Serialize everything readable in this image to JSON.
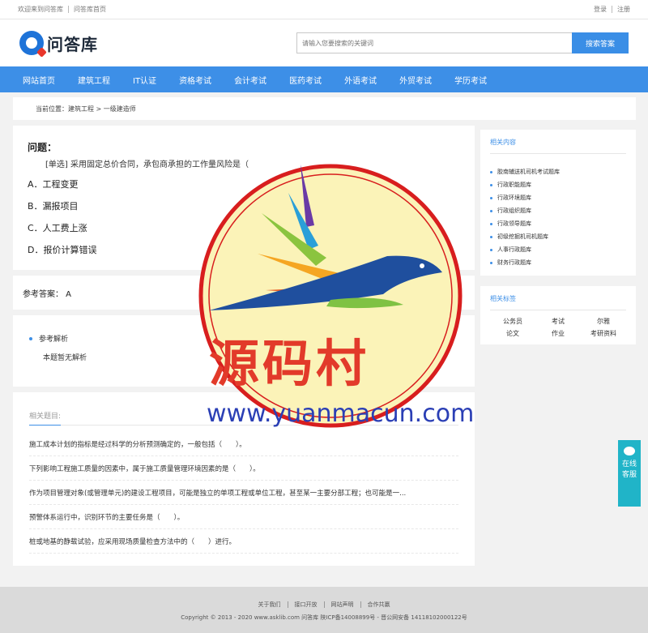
{
  "topbar": {
    "welcome": "欢迎来到问答库",
    "home_link": "问答库首页",
    "login": "登录",
    "register": "注册"
  },
  "header": {
    "logo_text": "问答库",
    "search_placeholder": "请输入您要搜索的关键词",
    "search_button": "搜索答案"
  },
  "nav": {
    "items": [
      "网站首页",
      "建筑工程",
      "IT认证",
      "资格考试",
      "会计考试",
      "医药考试",
      "外语考试",
      "外贸考试",
      "学历考试"
    ]
  },
  "breadcrumb": "当前位置：建筑工程 > 一级建造师",
  "question": {
    "title": "问题：",
    "stem": "[单选] 采用固定总价合同，承包商承担的工作量风险是（",
    "options": [
      "A．工程变更",
      "B．漏报项目",
      "C．人工费上涨",
      "D．报价计算错误"
    ]
  },
  "answer": "参考答案： A",
  "explanation": {
    "heading": "参考解析",
    "body": "本题暂无解析"
  },
  "related": {
    "heading": "相关题目:",
    "items": [
      "施工成本计划的指标是经过科学的分析预测确定的，一般包括（　　）。",
      "下列影响工程施工质量的因素中，属于施工质量管理环境因素的是（　　）。",
      "作为项目管理对象(或管理单元)的建设工程项目，可能是独立的单项工程或单位工程，甚至某一主要分部工程；也可能是一...",
      "预警体系运行中，识别环节的主要任务是（　　）。",
      "桩或地基的静载试验，应采用现场质量检查方法中的（　　）进行。"
    ]
  },
  "sidebar": {
    "related_content": {
      "heading": "相关内容",
      "items": [
        "胶南辅送机司机考试题库",
        "行政职能题库",
        "行政环境题库",
        "行政组织题库",
        "行政领导题库",
        "初级挖掘机司机题库",
        "人事行政题库",
        "财务行政题库"
      ]
    },
    "related_tags": {
      "heading": "相关标签",
      "items": [
        "公务员",
        "考试",
        "尔雅",
        "论文",
        "作业",
        "考研资料"
      ]
    }
  },
  "footer": {
    "links": [
      "关于我们",
      "接口开放",
      "网站声明",
      "合作共赢"
    ],
    "copyright": "Copyright © 2013 - 2020 www.asklib.com  问答库   陕ICP备14008899号 - 晋公网安备 14118102000122号"
  },
  "chat": {
    "line1": "在线",
    "line2": "客服"
  },
  "watermark": {
    "brand": "源码村",
    "url": "www.yuanmacun.com"
  },
  "colors": {
    "primary": "#3d8fe7",
    "chat": "#20b4c8",
    "watermark_red": "#e23a2a",
    "watermark_blue": "#2b3fb5"
  }
}
